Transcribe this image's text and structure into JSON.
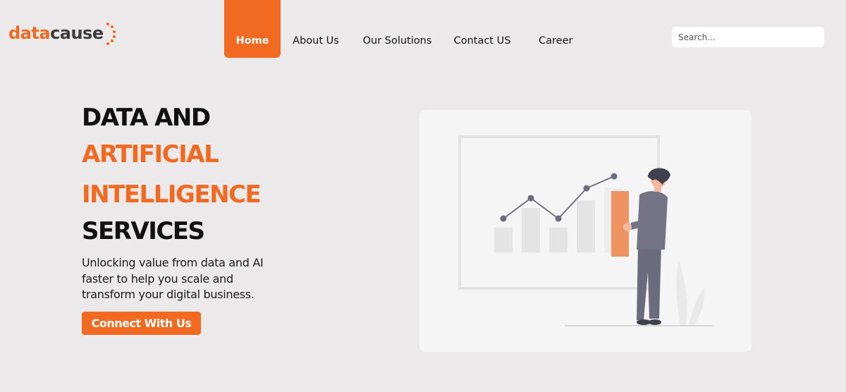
{
  "brand": {
    "logo_part1": "data",
    "logo_part2": "cause",
    "accent_color": "#f26a21"
  },
  "nav": {
    "items": [
      {
        "label": "Home",
        "active": true
      },
      {
        "label": "About Us"
      },
      {
        "label": "Our Solutions"
      },
      {
        "label": "Contact US"
      },
      {
        "label": "Career"
      }
    ]
  },
  "search": {
    "placeholder": "Search..."
  },
  "hero": {
    "title_line1": "DATA AND",
    "title_line2": "ARTIFICIAL",
    "title_line3": "INTELLIGENCE",
    "title_line4": "SERVICES",
    "subtitle": "Unlocking value from data and AI faster to help you scale and transform your digital business.",
    "cta_label": "Connect With Us"
  },
  "illustration": {
    "icon": "person-presenting-chart-illustration"
  }
}
